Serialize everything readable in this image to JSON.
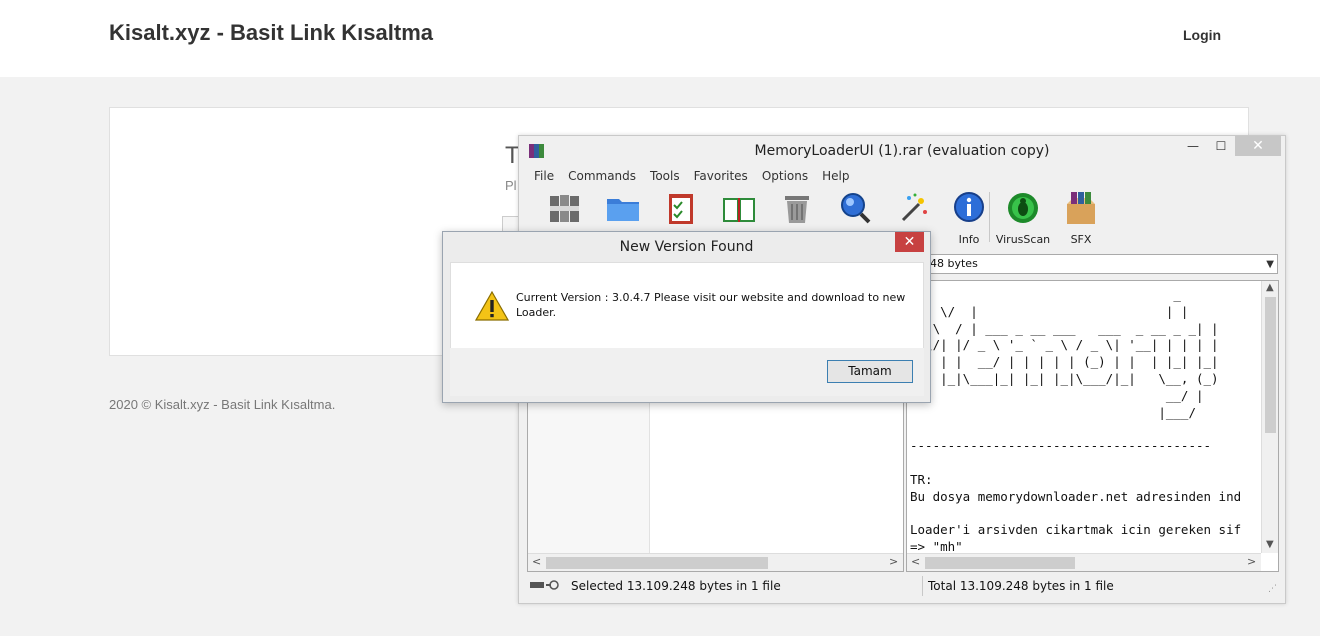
{
  "site": {
    "title": "Kisalt.xyz - Basit Link Kısaltma",
    "login": "Login",
    "card_heading_partial": "T",
    "card_sub_partial": "Pl",
    "footer": "2020 © Kisalt.xyz - Basit Link Kısaltma."
  },
  "winrar": {
    "title": "MemoryLoaderUI (1).rar (evaluation copy)",
    "window_buttons": {
      "minimize": "—",
      "maximize": "☐",
      "close": "✕"
    },
    "menu": [
      "File",
      "Commands",
      "Tools",
      "Favorites",
      "Options",
      "Help"
    ],
    "toolbar": {
      "info_label": "Info",
      "virusscan_label": "VirusScan",
      "sfx_label": "SFX"
    },
    "address_value": "48 bytes",
    "comment_lines": [
      "                                   _",
      " \\  \\/  |                         | |",
      " \\ \\  / | ___ _ __ ___   ___  _ __ _ _| |",
      " |\\/| |/ _ \\ '_ ` _ \\ / _ \\| '__| | | | |",
      " |  | |  __/ | | | | | (_) | |  | |_| |_|",
      " |  |_|\\___|_| |_| |_|\\___/|_|   \\__, (_)",
      "                                  __/ |",
      "                                 |___/",
      "",
      "----------------------------------------",
      "",
      "TR:",
      "Bu dosya memorydownloader.net adresinden ind",
      "",
      "Loader'i arsivden cikartmak icin gereken sif",
      "=> \"mh\""
    ],
    "status_left": "Selected 13.109.248 bytes in 1 file",
    "status_right": "Total 13.109.248 bytes in 1 file"
  },
  "dialog": {
    "title": "New Version Found",
    "close": "✕",
    "message": "Current Version : 3.0.4.7 Please visit our website and download to new Loader.",
    "ok_label": "Tamam"
  },
  "colors": {
    "dialog_close": "#c74141",
    "ok_border": "#3c7fb1"
  }
}
